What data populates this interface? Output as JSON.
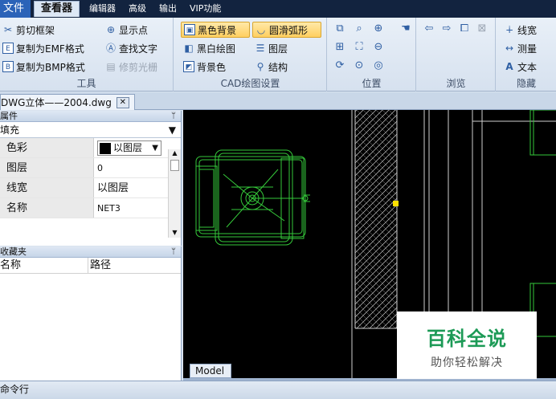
{
  "menubar": {
    "file": "文件",
    "viewer": "查看器",
    "editor": "编辑器",
    "advanced": "高级",
    "output": "输出",
    "vip": "VIP功能"
  },
  "ribbon": {
    "tools": {
      "label": "工具",
      "clip_frame": "剪切框架",
      "copy_emf": "复制为EMF格式",
      "copy_bmp": "复制为BMP格式",
      "show_points": "显示点",
      "find_text": "查找文字",
      "trim_raster": "修剪光栅"
    },
    "cad_settings": {
      "label": "CAD绘图设置",
      "black_bg": "黑色背景",
      "smooth_arc": "圆滑弧形",
      "bw_drawing": "黑白绘图",
      "layers": "图层",
      "bg_color": "背景色",
      "structure": "结构"
    },
    "position": {
      "label": "位置"
    },
    "browse": {
      "label": "浏览"
    },
    "hide": {
      "label": "隐藏",
      "line_width": "线宽",
      "measure": "测量",
      "text": "文本"
    }
  },
  "tabs": {
    "doc_title": "DWG立体——2004.dwg",
    "close": "✕"
  },
  "properties": {
    "header": "属件",
    "pin": "ᛘ",
    "combo_value": "填充",
    "rows": [
      {
        "name": "色彩",
        "value": "以图层"
      },
      {
        "name": "图层",
        "value": "0"
      },
      {
        "name": "线宽",
        "value": "以图层"
      },
      {
        "name": "名称",
        "value": "NET3"
      }
    ]
  },
  "favorites": {
    "header": "收藏夹",
    "col_name": "名称",
    "col_path": "路径"
  },
  "canvas": {
    "model_tab": "Model"
  },
  "watermark": {
    "title": "百科全说",
    "subtitle": "助你轻松解决"
  },
  "command_bar": {
    "label": "命令行"
  },
  "colors": {
    "cad_line": "#35c83a",
    "selection": "#ffe000",
    "brand_green": "#1c9a56"
  }
}
